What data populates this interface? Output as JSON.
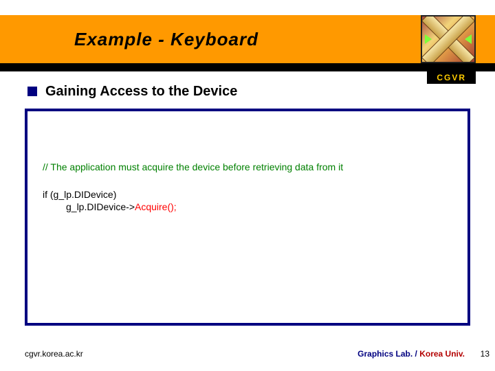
{
  "header": {
    "title": "Example - Keyboard",
    "tag": "CGVR"
  },
  "content": {
    "heading": "Gaining Access to the Device",
    "code": {
      "comment": "// The application must acquire the device before retrieving data from it",
      "line1": "if (g_lp.DIDevice)",
      "line2_prefix": "g_lp.DIDevice->",
      "line2_call": "Acquire();"
    }
  },
  "footer": {
    "left": "cgvr.korea.ac.kr",
    "right_lab": "Graphics Lab.",
    "right_sep": " / ",
    "right_univ": "Korea Univ.",
    "page_number": "13"
  }
}
